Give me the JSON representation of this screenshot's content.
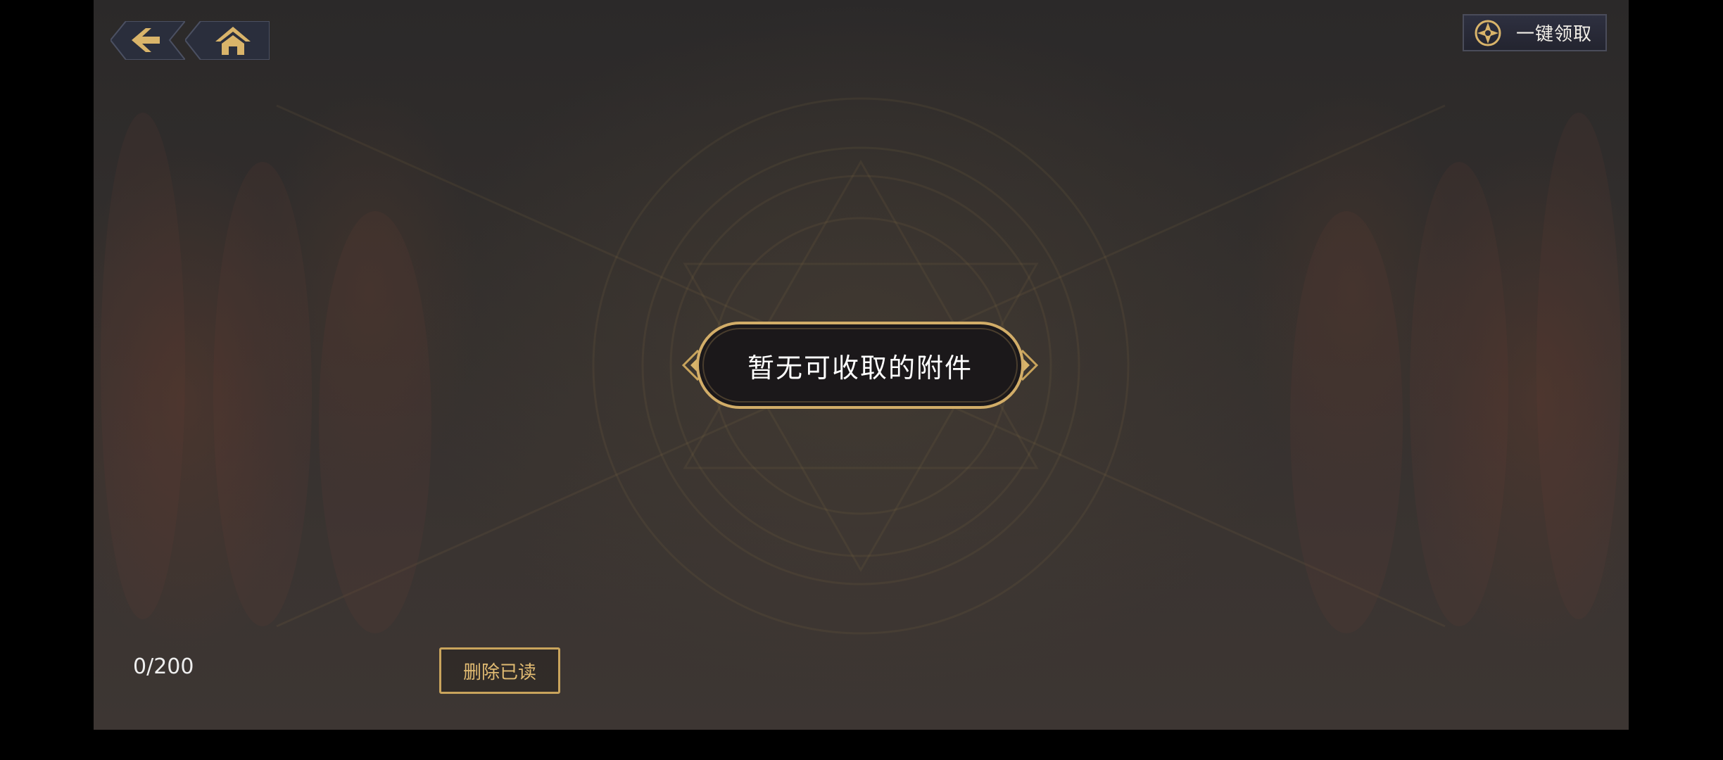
{
  "top_bar": {
    "back_icon": "back-arrow-icon",
    "home_icon": "home-icon",
    "claim_all": {
      "icon": "emblem-icon",
      "label": "一键领取"
    }
  },
  "empty_state": {
    "message": "暂无可收取的附件"
  },
  "footer": {
    "mail_count": "0/200",
    "delete_read_label": "删除已读"
  },
  "colors": {
    "gold": "#c9a45c",
    "gold_text": "#e1bb72",
    "panel_dark": "#1b181a",
    "background": "#332f2d"
  }
}
